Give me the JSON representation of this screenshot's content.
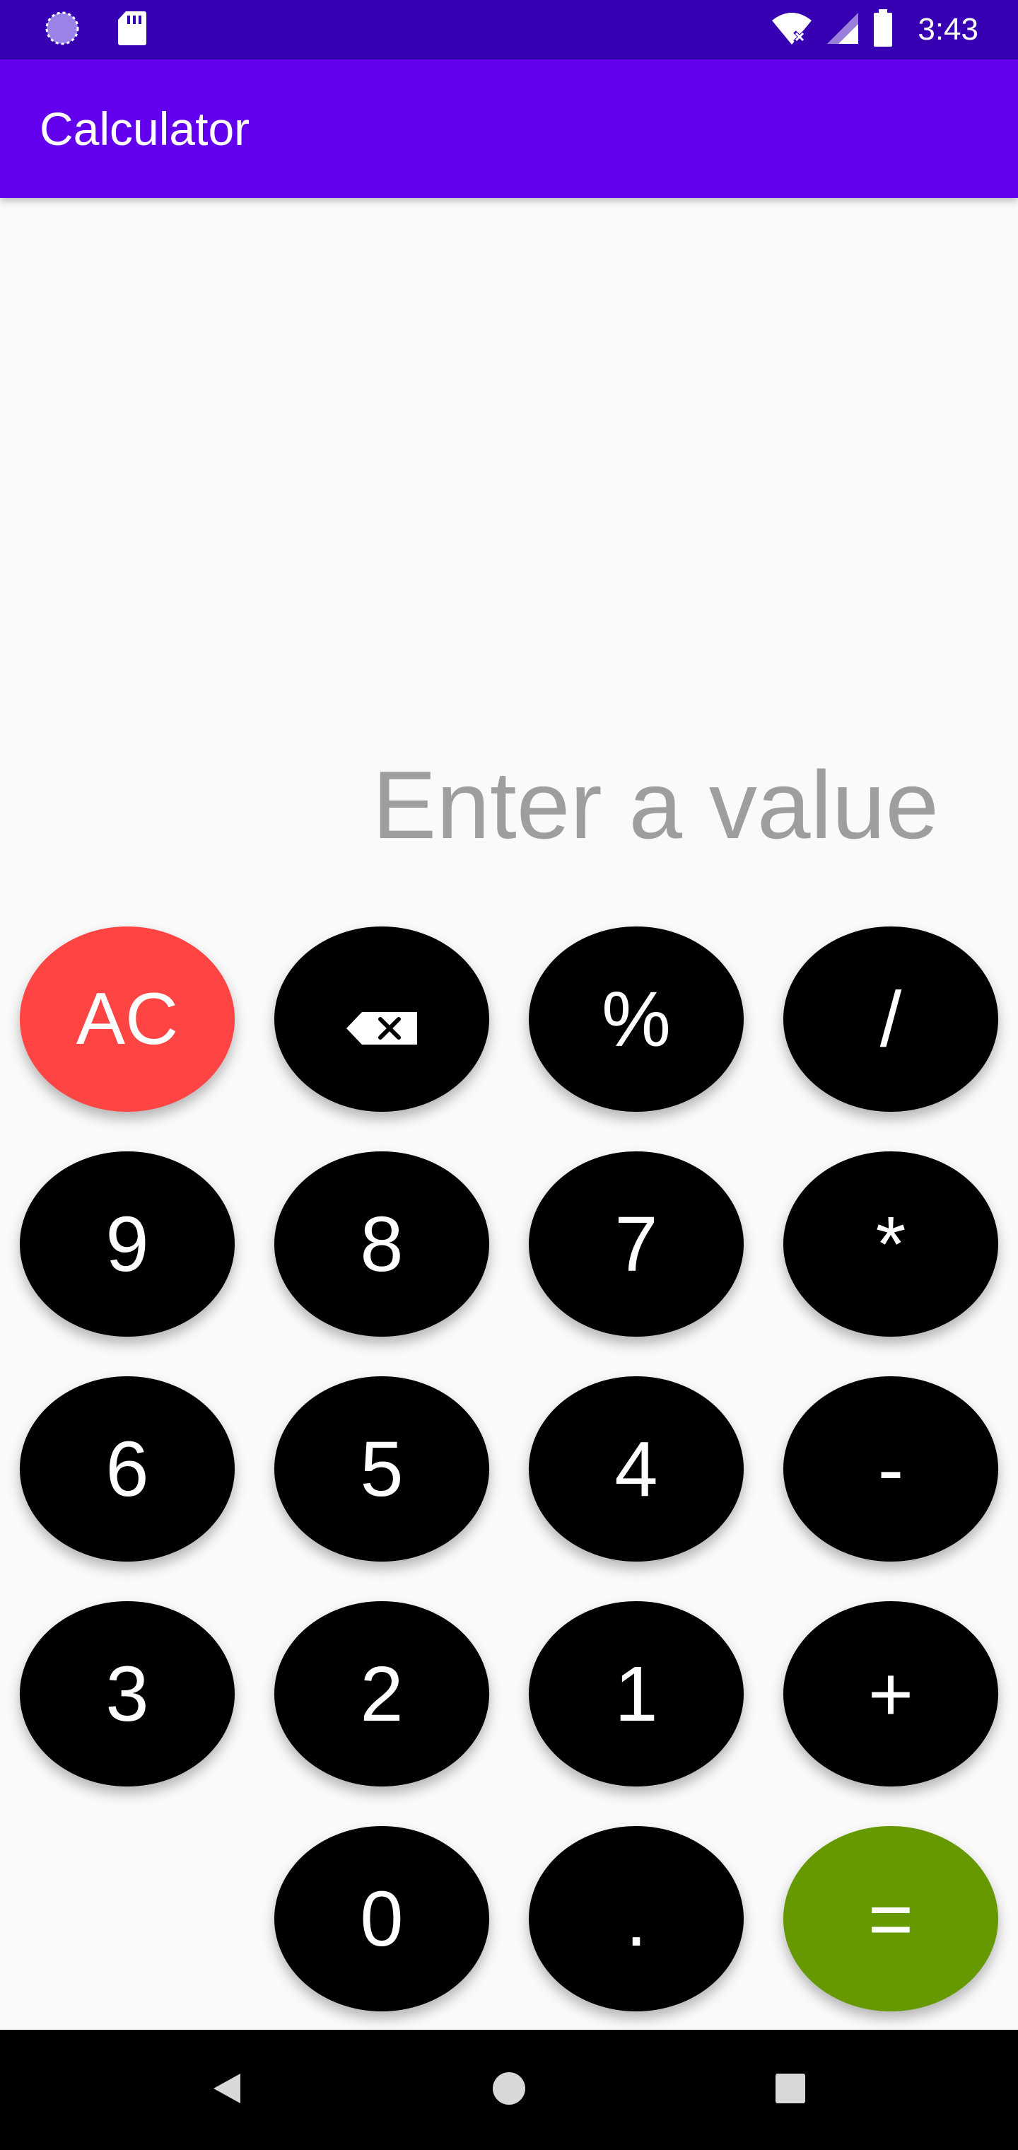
{
  "status_bar": {
    "time": "3:43",
    "icons": [
      "loading-icon",
      "sd-card-icon",
      "wifi-icon",
      "signal-icon",
      "battery-icon"
    ]
  },
  "app_bar": {
    "title": "Calculator"
  },
  "display": {
    "placeholder": "Enter a value"
  },
  "keypad": {
    "ac": "AC",
    "backspace_icon": "backspace-icon",
    "percent": "%",
    "divide": "/",
    "nine": "9",
    "eight": "8",
    "seven": "7",
    "multiply": "*",
    "six": "6",
    "five": "5",
    "four": "4",
    "minus": "-",
    "three": "3",
    "two": "2",
    "one": "1",
    "plus": "+",
    "zero": "0",
    "dot": ".",
    "equals": "="
  },
  "colors": {
    "status_bar": "#3700b3",
    "app_bar": "#6200ee",
    "ac_button": "#ff4444",
    "equals_button": "#669900",
    "key": "#000000"
  },
  "nav_bar": {
    "icons": [
      "back-icon",
      "home-icon",
      "recents-icon"
    ]
  }
}
